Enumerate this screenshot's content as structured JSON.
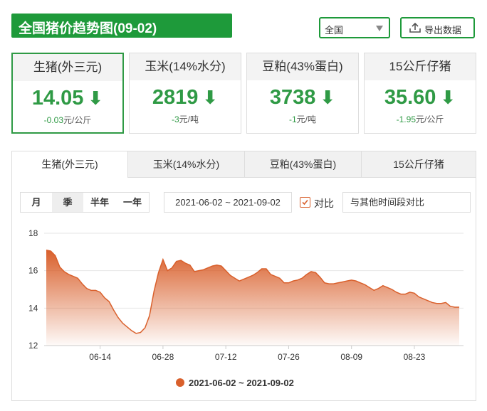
{
  "header": {
    "title": "全国猪价趋势图(09-02)",
    "region": "全国",
    "export_label": "导出数据"
  },
  "cards": [
    {
      "name": "生猪(外三元)",
      "price": "14.05",
      "change": "-0.03",
      "unit": "元/公斤"
    },
    {
      "name": "玉米(14%水分)",
      "price": "2819",
      "change": "-3",
      "unit": "元/吨"
    },
    {
      "name": "豆粕(43%蛋白)",
      "price": "3738",
      "change": "-1",
      "unit": "元/吨"
    },
    {
      "name": "15公斤仔猪",
      "price": "35.60",
      "change": "-1.95",
      "unit": "元/公斤"
    }
  ],
  "tabs": [
    "生猪(外三元)",
    "玉米(14%水分)",
    "豆粕(43%蛋白)",
    "15公斤仔猪"
  ],
  "periods": [
    "月",
    "季",
    "半年",
    "一年"
  ],
  "range": "2021-06-02 ~ 2021-09-02",
  "compare_label": "对比",
  "compare_placeholder": "与其他时间段对比",
  "colors": {
    "accent": "#1e9a3a",
    "price_green": "#2f9a45",
    "series": "#d9602c"
  },
  "chart_data": {
    "type": "area",
    "ylim": [
      12,
      18
    ],
    "yticks": [
      "12",
      "14",
      "16",
      "18"
    ],
    "xticks": [
      "06-14",
      "06-28",
      "07-12",
      "07-26",
      "08-09",
      "08-23"
    ],
    "x": [
      "06-02",
      "06-03",
      "06-04",
      "06-05",
      "06-06",
      "06-07",
      "06-08",
      "06-09",
      "06-10",
      "06-11",
      "06-12",
      "06-13",
      "06-14",
      "06-15",
      "06-16",
      "06-17",
      "06-18",
      "06-19",
      "06-20",
      "06-21",
      "06-22",
      "06-23",
      "06-24",
      "06-25",
      "06-26",
      "06-27",
      "06-28",
      "06-29",
      "06-30",
      "07-01",
      "07-02",
      "07-03",
      "07-04",
      "07-05",
      "07-06",
      "07-07",
      "07-08",
      "07-09",
      "07-10",
      "07-11",
      "07-12",
      "07-13",
      "07-14",
      "07-15",
      "07-16",
      "07-17",
      "07-18",
      "07-19",
      "07-20",
      "07-21",
      "07-22",
      "07-23",
      "07-24",
      "07-25",
      "07-26",
      "07-27",
      "07-28",
      "07-29",
      "07-30",
      "07-31",
      "08-01",
      "08-02",
      "08-03",
      "08-04",
      "08-05",
      "08-06",
      "08-07",
      "08-08",
      "08-09",
      "08-10",
      "08-11",
      "08-12",
      "08-13",
      "08-14",
      "08-15",
      "08-16",
      "08-17",
      "08-18",
      "08-19",
      "08-20",
      "08-21",
      "08-22",
      "08-23",
      "08-24",
      "08-25",
      "08-26",
      "08-27",
      "08-28",
      "08-29",
      "08-30",
      "08-31",
      "09-01",
      "09-02"
    ],
    "series": [
      {
        "name": "2021-06-02 ~ 2021-09-02",
        "values": [
          17.1,
          17.05,
          16.8,
          16.2,
          15.95,
          15.8,
          15.7,
          15.6,
          15.3,
          15.05,
          14.95,
          14.95,
          14.85,
          14.55,
          14.35,
          13.9,
          13.5,
          13.2,
          13.0,
          12.8,
          12.65,
          12.7,
          12.95,
          13.6,
          14.9,
          15.9,
          16.6,
          16.0,
          16.15,
          16.5,
          16.55,
          16.4,
          16.3,
          15.95,
          16.0,
          16.05,
          16.15,
          16.25,
          16.3,
          16.25,
          16.0,
          15.75,
          15.6,
          15.45,
          15.55,
          15.65,
          15.75,
          15.9,
          16.1,
          16.1,
          15.8,
          15.7,
          15.6,
          15.35,
          15.35,
          15.45,
          15.5,
          15.6,
          15.8,
          15.95,
          15.9,
          15.65,
          15.35,
          15.3,
          15.3,
          15.35,
          15.4,
          15.45,
          15.5,
          15.45,
          15.35,
          15.25,
          15.1,
          14.95,
          15.05,
          15.2,
          15.1,
          15.0,
          14.85,
          14.75,
          14.75,
          14.85,
          14.8,
          14.6,
          14.5,
          14.4,
          14.3,
          14.25,
          14.25,
          14.3,
          14.1,
          14.05,
          14.05
        ]
      }
    ],
    "legend": "2021-06-02 ~ 2021-09-02",
    "grid": true
  }
}
